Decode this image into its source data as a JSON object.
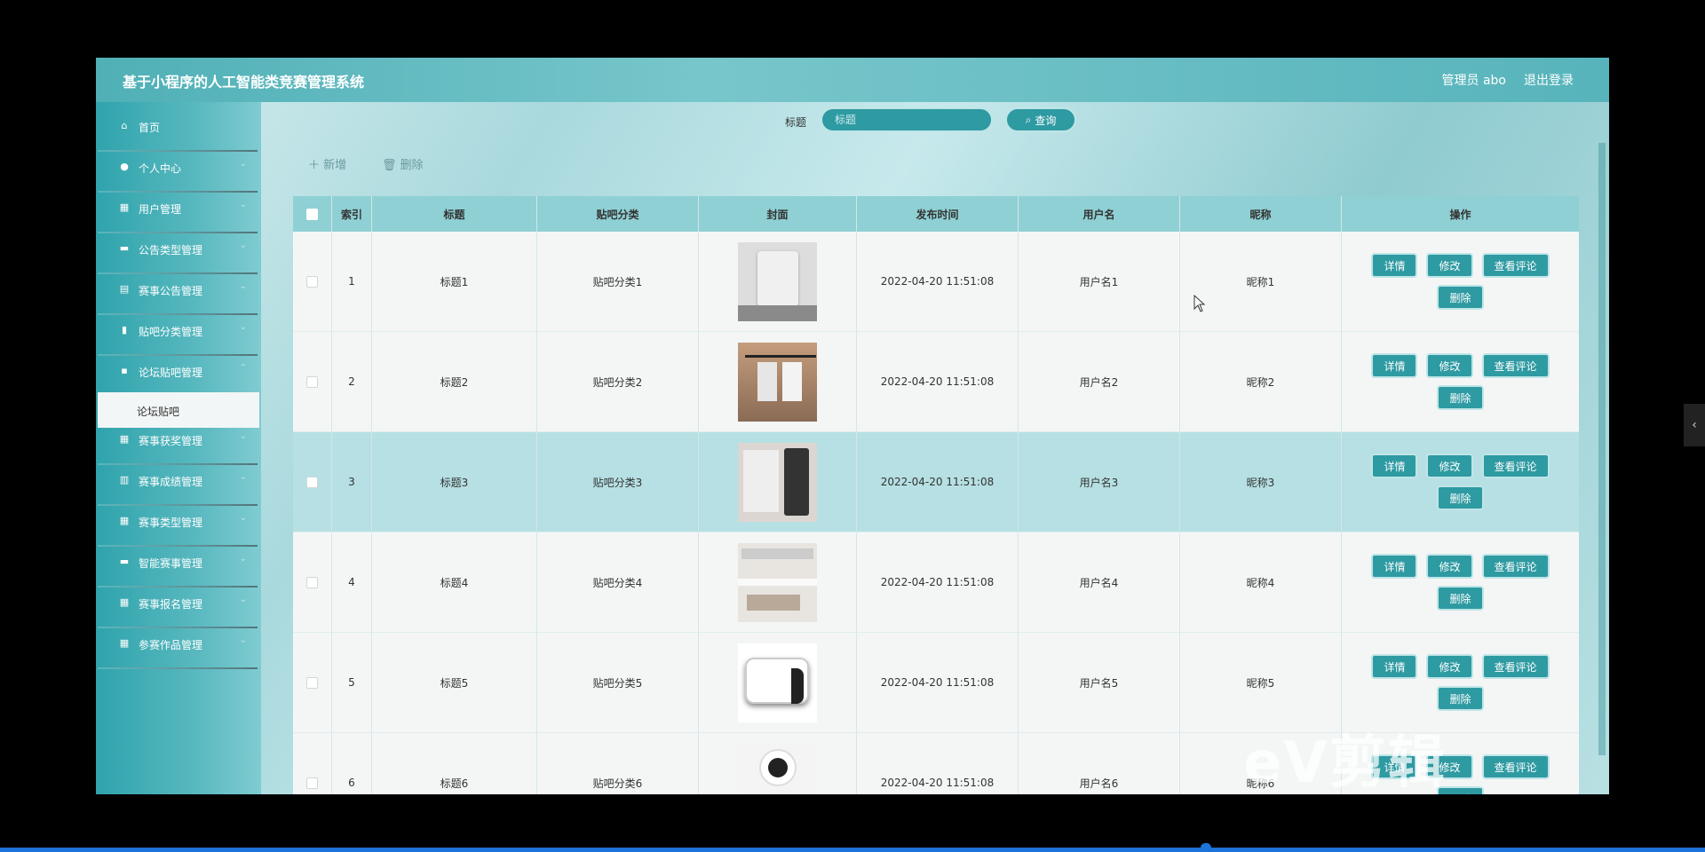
{
  "app": {
    "title": "基于小程序的人工智能类竞赛管理系统",
    "admin_label": "管理员 abo",
    "logout_label": "退出登录"
  },
  "sidebar": {
    "items": [
      {
        "label": "首页",
        "icon": "home-icon"
      },
      {
        "label": "个人中心",
        "icon": "user-icon"
      },
      {
        "label": "用户管理",
        "icon": "grid-icon"
      },
      {
        "label": "公告类型管理",
        "icon": "monitor-icon"
      },
      {
        "label": "赛事公告管理",
        "icon": "doc-icon"
      },
      {
        "label": "贴吧分类管理",
        "icon": "bar-chart-icon"
      },
      {
        "label": "论坛贴吧管理",
        "icon": "chat-icon"
      },
      {
        "label": "赛事获奖管理",
        "icon": "grid-icon"
      },
      {
        "label": "赛事成绩管理",
        "icon": "book-icon"
      },
      {
        "label": "赛事类型管理",
        "icon": "grid-icon"
      },
      {
        "label": "智能赛事管理",
        "icon": "comment-icon"
      },
      {
        "label": "赛事报名管理",
        "icon": "grid-icon"
      },
      {
        "label": "参赛作品管理",
        "icon": "grid-icon"
      }
    ],
    "active_submenu": "论坛贴吧"
  },
  "search": {
    "label": "标题",
    "placeholder": "标题",
    "button_label": "查询"
  },
  "toolbar": {
    "add_label": "新增",
    "delete_label": "删除"
  },
  "table": {
    "columns": [
      "索引",
      "标题",
      "贴吧分类",
      "封面",
      "发布时间",
      "用户名",
      "昵称",
      "操作"
    ],
    "rows": [
      {
        "index": "1",
        "title": "标题1",
        "category": "贴吧分类1",
        "time": "2022-04-20 11:51:08",
        "username": "用户名1",
        "nickname": "昵称1"
      },
      {
        "index": "2",
        "title": "标题2",
        "category": "贴吧分类2",
        "time": "2022-04-20 11:51:08",
        "username": "用户名2",
        "nickname": "昵称2"
      },
      {
        "index": "3",
        "title": "标题3",
        "category": "贴吧分类3",
        "time": "2022-04-20 11:51:08",
        "username": "用户名3",
        "nickname": "昵称3"
      },
      {
        "index": "4",
        "title": "标题4",
        "category": "贴吧分类4",
        "time": "2022-04-20 11:51:08",
        "username": "用户名4",
        "nickname": "昵称4"
      },
      {
        "index": "5",
        "title": "标题5",
        "category": "贴吧分类5",
        "time": "2022-04-20 11:51:08",
        "username": "用户名5",
        "nickname": "昵称5"
      },
      {
        "index": "6",
        "title": "标题6",
        "category": "贴吧分类6",
        "time": "2022-04-20 11:51:08",
        "username": "用户名6",
        "nickname": "昵称6"
      }
    ],
    "actions": {
      "detail": "详情",
      "edit": "修改",
      "comments": "查看评论",
      "delete": "删除"
    }
  },
  "watermark": "eV剪辑",
  "colors": {
    "accent": "#2e9aa2",
    "header": "#8fd0d4",
    "highlight_row": "#b6e0e3"
  }
}
